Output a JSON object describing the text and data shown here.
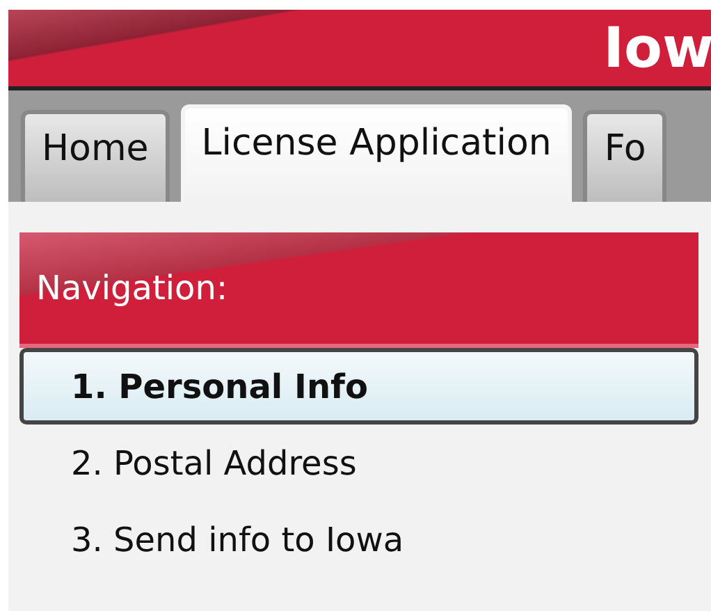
{
  "header": {
    "title": "Iow"
  },
  "tabs": [
    {
      "label": "Home",
      "selected": false
    },
    {
      "label": "License Application",
      "selected": true
    },
    {
      "label": "Fo",
      "selected": false
    }
  ],
  "navigation": {
    "title": "Navigation:",
    "items": [
      {
        "label": "1. Personal Info",
        "selected": true
      },
      {
        "label": "2. Postal Address",
        "selected": false
      },
      {
        "label": "3. Send info to Iowa",
        "selected": false
      }
    ]
  }
}
